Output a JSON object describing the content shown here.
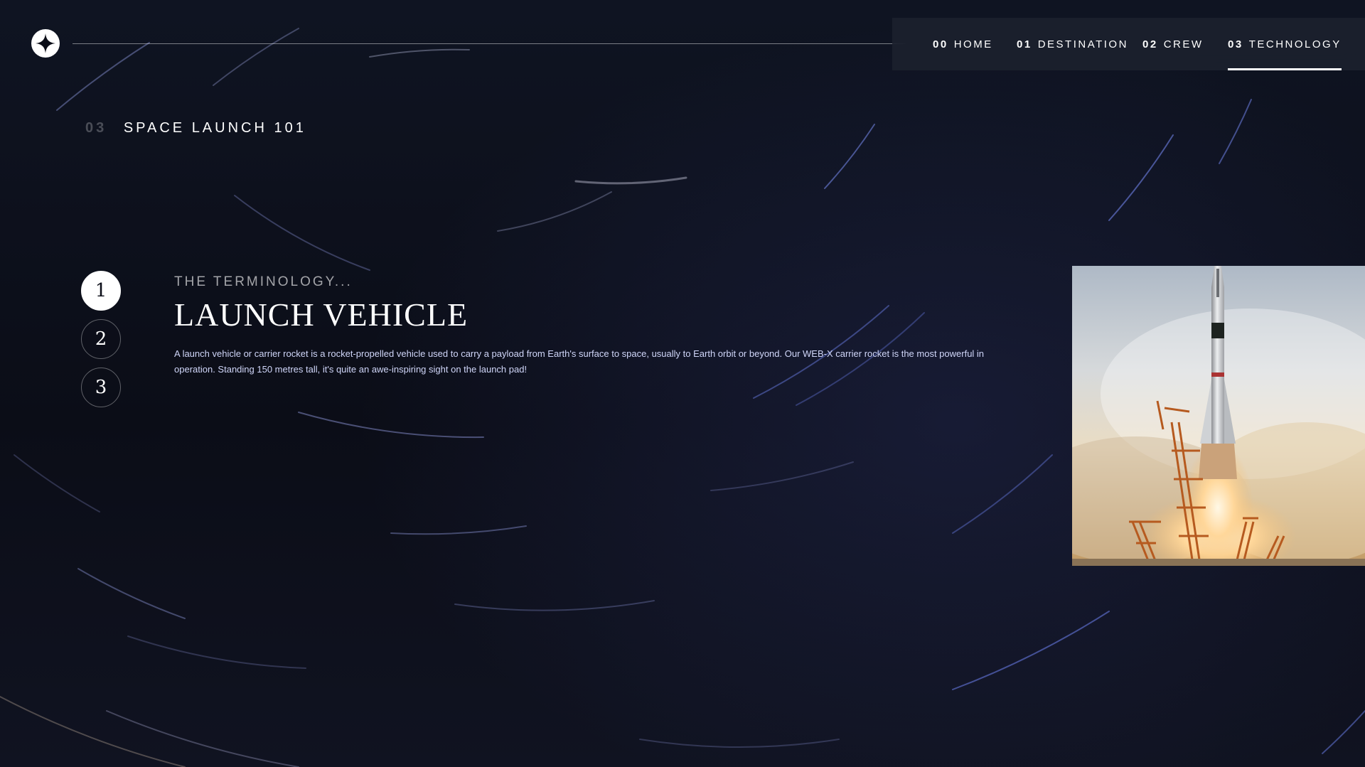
{
  "app": {
    "logo_icon": "star-logo-icon"
  },
  "nav": {
    "items": [
      {
        "num": "00",
        "label": "HOME"
      },
      {
        "num": "01",
        "label": "DESTINATION"
      },
      {
        "num": "02",
        "label": "CREW"
      },
      {
        "num": "03",
        "label": "TECHNOLOGY"
      }
    ],
    "active_index": 3
  },
  "page": {
    "eyebrow_num": "03",
    "eyebrow_text": "SPACE LAUNCH 101"
  },
  "steps": [
    {
      "label": "1"
    },
    {
      "label": "2"
    },
    {
      "label": "3"
    }
  ],
  "active_step": 0,
  "tech": {
    "subheading": "THE TERMINOLOGY...",
    "title": "LAUNCH VEHICLE",
    "description": "A launch vehicle or carrier rocket is a rocket-propelled vehicle used to carry a payload from Earth's surface to space, usually to Earth orbit or beyond. Our WEB-X carrier rocket is the most powerful in operation. Standing 150 metres tall, it's quite an awe-inspiring sight on the launch pad!"
  },
  "image": {
    "subject": "rocket-launch-photo"
  },
  "colors": {
    "background": "#0b0d17",
    "accent_text": "#d0d6f9",
    "white": "#ffffff"
  }
}
